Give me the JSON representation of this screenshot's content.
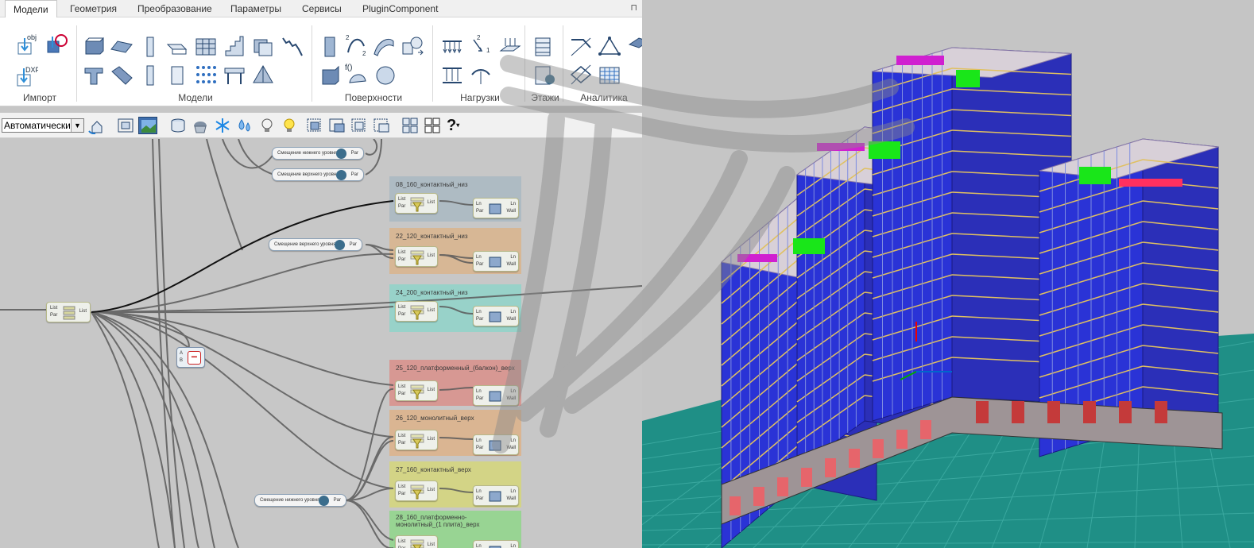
{
  "tabs": [
    "Модели",
    "Геометрия",
    "Преобразование",
    "Параметры",
    "Сервисы",
    "PluginComponent"
  ],
  "active_tab": "Модели",
  "pin_icon": "⊓",
  "ribbon": {
    "groups": [
      {
        "label": "Импорт",
        "icons": [
          "import-obj-icon",
          "import-link-icon",
          "import-dxf-icon"
        ],
        "texts": [
          "obj",
          "DXF"
        ]
      },
      {
        "label": "Модели",
        "icons": [
          "slab-icon",
          "plate-icon",
          "column-icon",
          "beam-icon",
          "wall-icon",
          "stair-icon",
          "block-icon",
          "spring-icon",
          "tbeam-icon",
          "inclined-plate-icon",
          "pile-icon",
          "panel-icon",
          "grid-points-icon",
          "table-icon",
          "pyramid-icon"
        ]
      },
      {
        "label": "Поверхности",
        "icons": [
          "surface-panel-icon",
          "spline-icon",
          "shell-icon",
          "solid-icon",
          "box-icon",
          "function-surface-icon",
          "sphere-icon"
        ],
        "texts": [
          "2",
          "2",
          "f()"
        ]
      },
      {
        "label": "Нагрузки",
        "icons": [
          "distributed-load-icon",
          "point-load-icon",
          "area-load-icon",
          "linear-load-icon",
          "support-icon"
        ],
        "texts": [
          "2",
          "1"
        ]
      },
      {
        "label": "Этажи",
        "icons": [
          "floors-icon",
          "floor-settings-icon"
        ]
      },
      {
        "label": "Аналитика",
        "icons": [
          "analytics-lines-icon",
          "triangle-icon",
          "analytics-plane-icon",
          "grid-icon",
          "analytics-extra-icon"
        ]
      }
    ]
  },
  "toolbar": {
    "display_mode": "Автоматически",
    "icons": [
      "refresh-house-icon",
      "zoom-extents-icon",
      "render-icon",
      "layers-icon",
      "muffin-icon",
      "snowflake-icon",
      "drops-icon",
      "bulb-off-icon",
      "bulb-on-icon",
      "select-1-icon",
      "select-2-icon",
      "select-3-icon",
      "select-4-icon",
      "layout-2x2-icon",
      "layout-grid-icon",
      "help-icon"
    ],
    "help_glyph": "?"
  },
  "graph": {
    "pills": [
      {
        "label": "Смещение нижнего уровня",
        "port": "Par"
      },
      {
        "label": "Смещение верхнего уровня",
        "port": "Par"
      },
      {
        "label": "Смещение верхнего уровня",
        "port": "Par"
      },
      {
        "label": "Смещение нижнего уровня",
        "port": "Par"
      }
    ],
    "groups": [
      {
        "title": "08_160_контактный_низ",
        "color": "#a9b8c2"
      },
      {
        "title": "22_120_контактный_низ",
        "color": "#d9b48c"
      },
      {
        "title": "24_200_контактный_низ",
        "color": "#8fd4c9"
      },
      {
        "title": "25_120_платформенный_(балкон)_верх",
        "color": "#d98f8a"
      },
      {
        "title": "26_120_монолитный_верх",
        "color": "#ddb188"
      },
      {
        "title": "27_160_контактный_верх",
        "color": "#d5d67a"
      },
      {
        "title": "28_160_платформенно-монолитный_(1 плита)_верх",
        "color": "#8fd68a"
      }
    ],
    "port_labels": {
      "list": "List",
      "par": "Par",
      "ln": "Ln",
      "wall": "Wall",
      "a": "A",
      "b": "B"
    },
    "main_node": {
      "inputs": [
        "List",
        "Par"
      ],
      "output": "List"
    },
    "minus_node": {
      "inputs": [
        "A",
        "B"
      ],
      "glyph": "−"
    }
  },
  "colors": {
    "building_blue": "#2a33d6",
    "ground": "#1f8f86",
    "accent_green": "#19e619"
  }
}
